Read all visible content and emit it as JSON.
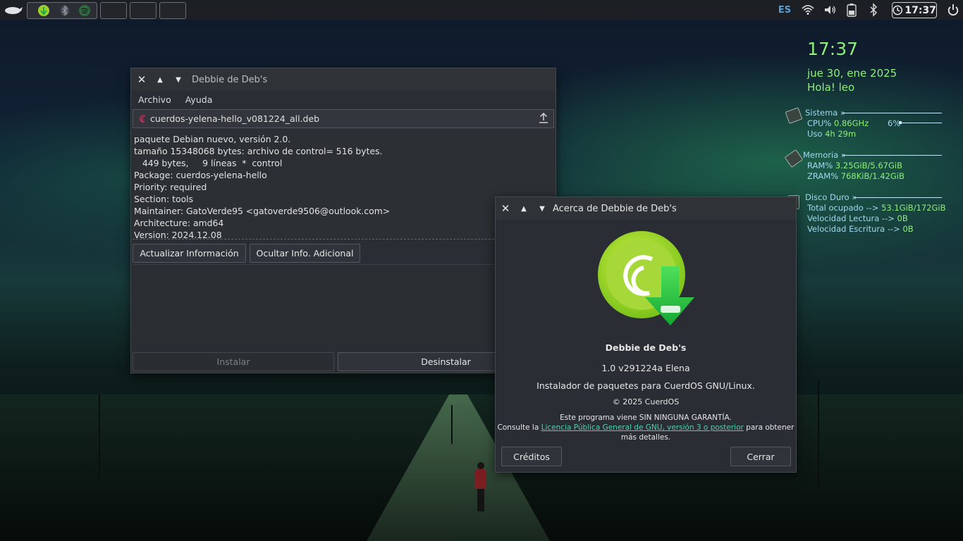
{
  "panel": {
    "language": "ES",
    "clock": "17:37",
    "icons": [
      "linux-logo-icon",
      "app-icon-debbie",
      "bluetooth-icon",
      "spotify-icon",
      "wifi-icon",
      "volume-icon",
      "battery-icon",
      "bluetooth-icon",
      "clock-icon",
      "power-icon"
    ]
  },
  "conky": {
    "time": "17:37",
    "date": "jue 30, ene 2025",
    "greeting": "Hola! leo",
    "sistema": {
      "heading": "Sistema »",
      "cpu_label": "CPU%",
      "cpu_freq": "0.86GHz",
      "cpu_pct": "6%",
      "cpu_fraction": 0.06,
      "uptime_label": "Uso",
      "uptime": "4h 29m"
    },
    "memoria": {
      "heading": "Memoria »",
      "ram_label": "RAM%",
      "ram": "3.25GiB/5.67GiB",
      "zram_label": "ZRAM%",
      "zram": "768KiB/1.42GiB"
    },
    "disco": {
      "heading": "Disco Duro »",
      "total_label": "Total ocupado -->",
      "total": "53.1GiB/172GiB",
      "read_label": "Velocidad Lectura -->",
      "read": "0B",
      "write_label": "Velocidad Escritura -->",
      "write": "0B"
    }
  },
  "main_window": {
    "title": "Debbie de Deb's",
    "menu": [
      "Archivo",
      "Ayuda"
    ],
    "file_name": "cuerdos-yelena-hello_v081224_all.deb",
    "info_lines": [
      "paquete Debian nuevo, versión 2.0.",
      "tamaño 15348068 bytes: archivo de control= 516 bytes.",
      "   449 bytes,     9 líneas  *  control",
      "Package: cuerdos-yelena-hello",
      "Priority: required",
      "Section: tools",
      "Maintainer: GatoVerde95 <gatoverde9506@outlook.com>",
      "Architecture: amd64",
      "Version: 2024.12.08"
    ],
    "btn_update": "Actualizar Información",
    "btn_hide": "Ocultar Info. Adicional",
    "btn_install": "Instalar",
    "btn_uninstall": "Desinstalar"
  },
  "about": {
    "title": "Acerca de Debbie de Deb's",
    "app_name": "Debbie de Deb's",
    "version": "1.0 v291224a Elena",
    "description": "Instalador de paquetes para CuerdOS GNU/Linux.",
    "copyright": "© 2025 CuerdOS",
    "warranty": "Este programa viene SIN NINGUNA GARANTÍA.",
    "license_prefix": "Consulte la",
    "license_link": "Licencia Pública General de GNU, versión 3 o posterior",
    "license_suffix": "para obtener",
    "license_end": "más detalles.",
    "btn_credits": "Créditos",
    "btn_close": "Cerrar"
  }
}
